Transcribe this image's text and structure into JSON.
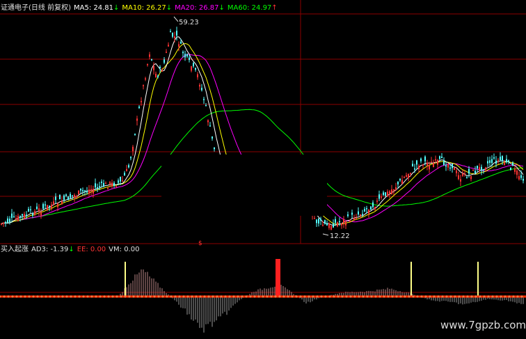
{
  "main_legend": {
    "title": "证通电子(日线 前复权)",
    "ma5": "MA5: 24.81",
    "ma5_arrow": "↓",
    "ma10": "MA10: 26.27",
    "ma10_arrow": "↓",
    "ma20": "MA20: 26.87",
    "ma20_arrow": "↓",
    "ma60": "MA60: 24.97",
    "ma60_arrow": "↑"
  },
  "sub_legend": {
    "title": "买入起涨",
    "ad3": "AD3: -1.39",
    "ad3_arrow": "↓",
    "ee": "EE: 0.00",
    "vm": "VM: 0.00"
  },
  "annotations": {
    "high": "59.23",
    "low": "12.22",
    "marker": "$"
  },
  "watermark": "www.7gpzb.com",
  "colors": {
    "background": "#000000",
    "grid": "#8b0000",
    "up_candle": "#ff3333",
    "down_candle": "#54ffff",
    "ma5": "#ffffff",
    "ma10": "#ffff00",
    "ma20": "#ff00ff",
    "ma60": "#00ff00",
    "baseline": "#ff2a00",
    "signal_bar": "#ffff88",
    "buy_bar": "#ff2020"
  }
}
